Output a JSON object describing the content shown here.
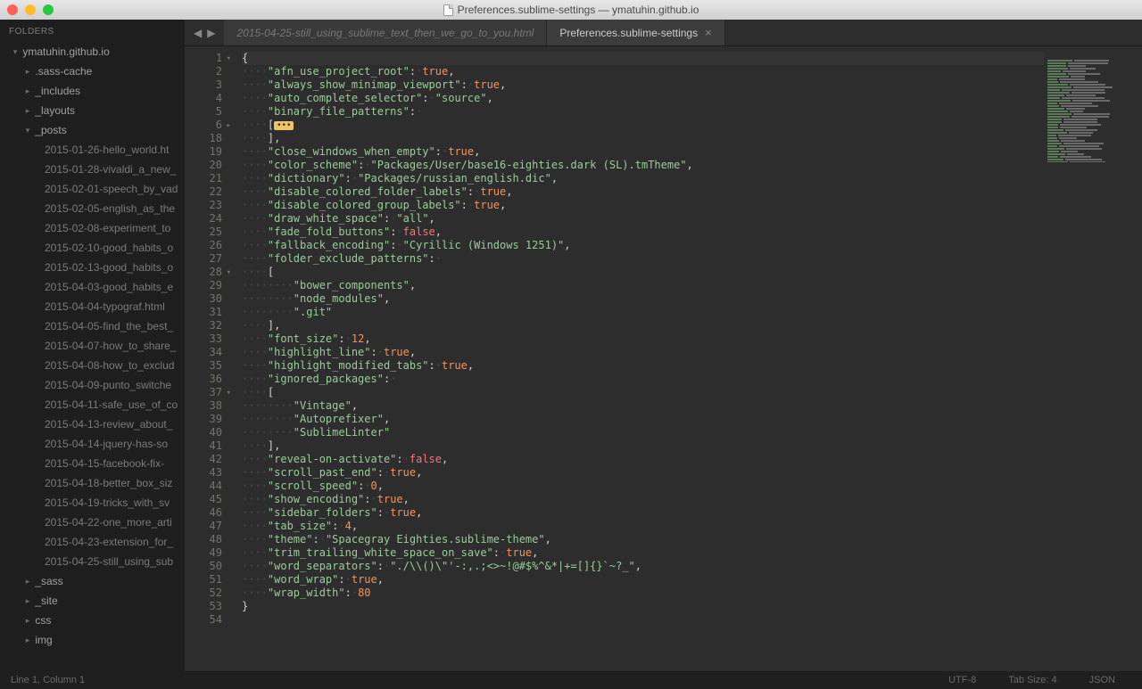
{
  "window": {
    "title": "Preferences.sublime-settings — ymatuhin.github.io"
  },
  "sidebar": {
    "header": "FOLDERS",
    "root": "ymatuhin.github.io",
    "folders": [
      {
        "name": ".sass-cache",
        "expanded": false
      },
      {
        "name": "_includes",
        "expanded": false
      },
      {
        "name": "_layouts",
        "expanded": false
      },
      {
        "name": "_posts",
        "expanded": true
      }
    ],
    "post_files": [
      "2015-01-26-hello_world.ht",
      "2015-01-28-vivaldi_a_new_",
      "2015-02-01-speech_by_vad",
      "2015-02-05-english_as_the",
      "2015-02-08-experiment_to",
      "2015-02-10-good_habits_o",
      "2015-02-13-good_habits_o",
      "2015-04-03-good_habits_e",
      "2015-04-04-typograf.html",
      "2015-04-05-find_the_best_",
      "2015-04-07-how_to_share_",
      "2015-04-08-how_to_exclud",
      "2015-04-09-punto_switche",
      "2015-04-11-safe_use_of_co",
      "2015-04-13-review_about_",
      "2015-04-14-jquery-has-so",
      "2015-04-15-facebook-fix-",
      "2015-04-18-better_box_siz",
      "2015-04-19-tricks_with_sv",
      "2015-04-22-one_more_arti",
      "2015-04-23-extension_for_",
      "2015-04-25-still_using_sub"
    ],
    "tail_folders": [
      "_sass",
      "_site",
      "css",
      "img"
    ]
  },
  "tabs": {
    "inactive": "2015-04-25-still_using_sublime_text_then_we_go_to_you.html",
    "active": "Preferences.sublime-settings"
  },
  "code": {
    "line_numbers": [
      "1",
      "2",
      "3",
      "4",
      "5",
      "6",
      "18",
      "19",
      "20",
      "21",
      "22",
      "23",
      "24",
      "25",
      "26",
      "27",
      "28",
      "29",
      "30",
      "31",
      "32",
      "33",
      "34",
      "35",
      "36",
      "37",
      "38",
      "39",
      "40",
      "41",
      "42",
      "43",
      "44",
      "45",
      "46",
      "47",
      "48",
      "49",
      "50",
      "51",
      "52",
      "53",
      "54"
    ],
    "settings": {
      "afn_use_project_root": true,
      "always_show_minimap_viewport": true,
      "auto_complete_selector": "source",
      "binary_file_patterns_key": "binary_file_patterns",
      "close_windows_when_empty": true,
      "color_scheme": "Packages/User/base16-eighties.dark (SL).tmTheme",
      "dictionary": "Packages/russian_english.dic",
      "disable_colored_folder_labels": true,
      "disable_colored_group_labels": true,
      "draw_white_space": "all",
      "fade_fold_buttons": false,
      "fallback_encoding": "Cyrillic (Windows 1251)",
      "folder_exclude_patterns_key": "folder_exclude_patterns",
      "folder_exclude_patterns": [
        "bower_components",
        "node_modules",
        ".git"
      ],
      "font_size": 12,
      "highlight_line": true,
      "highlight_modified_tabs": true,
      "ignored_packages_key": "ignored_packages",
      "ignored_packages": [
        "Vintage",
        "Autoprefixer",
        "SublimeLinter"
      ],
      "reveal-on-activate": false,
      "scroll_past_end": true,
      "scroll_speed": 0,
      "show_encoding": true,
      "sidebar_folders": true,
      "tab_size": 4,
      "theme": "Spacegray Eighties.sublime-theme",
      "trim_trailing_white_space_on_save": true,
      "word_separators": "./\\\\()\\\"'-:,.;<>~!@#$%^&*|+=[]{}`~?_",
      "word_wrap": true,
      "wrap_width": 80
    }
  },
  "statusbar": {
    "position": "Line 1, Column 1",
    "encoding": "UTF-8",
    "tab_size": "Tab Size: 4",
    "syntax": "JSON"
  }
}
